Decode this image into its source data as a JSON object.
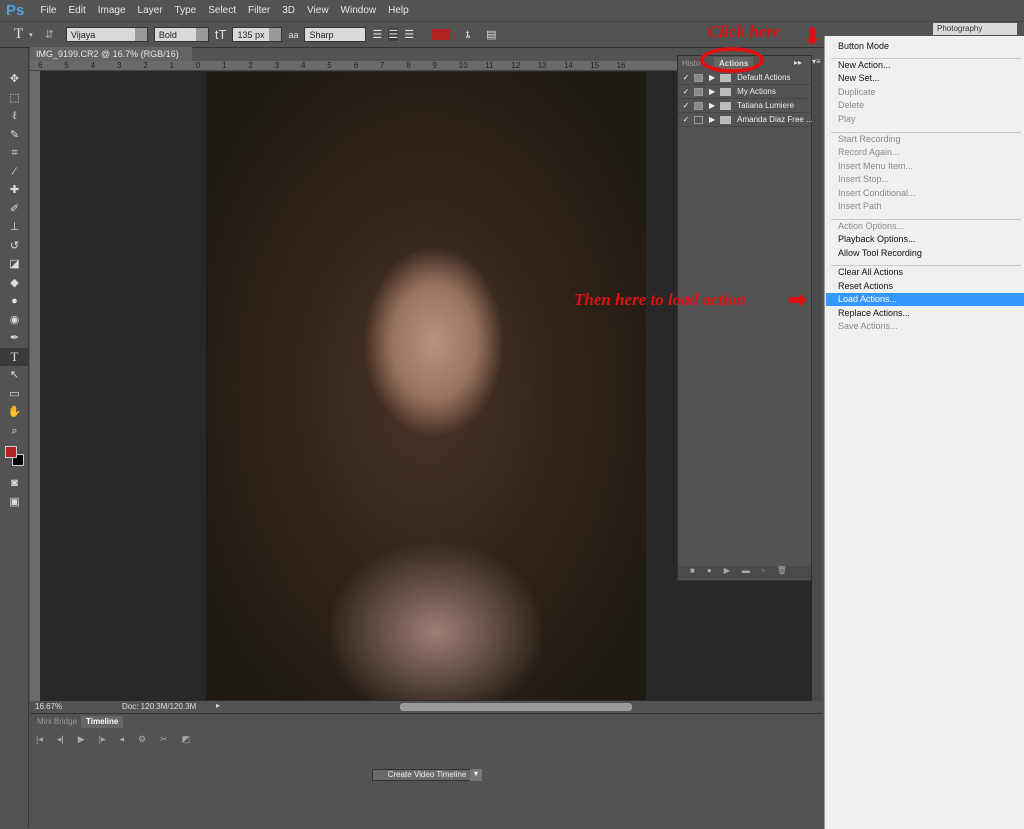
{
  "app": {
    "logo": "Ps",
    "menus": [
      "File",
      "Edit",
      "Image",
      "Layer",
      "Type",
      "Select",
      "Filter",
      "3D",
      "View",
      "Window",
      "Help"
    ],
    "workspace": "Photography"
  },
  "options": {
    "font": "Vijaya",
    "style": "Bold",
    "size": "135 px",
    "aa_label": "aa",
    "aa": "Sharp",
    "color": "#b22222"
  },
  "document": {
    "tab": "IMG_9199.CR2 @ 16.7% (RGB/16)",
    "close": "×",
    "ruler": [
      "6",
      "5",
      "4",
      "3",
      "2",
      "1",
      "0",
      "1",
      "2",
      "3",
      "4",
      "5",
      "6",
      "7",
      "8",
      "9",
      "10",
      "11",
      "12",
      "13",
      "14",
      "15",
      "16"
    ]
  },
  "status": {
    "zoom": "16.67%",
    "doc": "Doc: 120.3M/120.3M"
  },
  "timeline": {
    "tabs": [
      "Mini Bridge",
      "Timeline"
    ],
    "create": "Create Video Timeline"
  },
  "actions_panel": {
    "tabs": [
      "Histo",
      "Actions"
    ],
    "items": [
      {
        "name": "Default Actions",
        "checked": true
      },
      {
        "name": "My Actions",
        "checked": true
      },
      {
        "name": "Tatiana Lumiere",
        "checked": true
      },
      {
        "name": "Amanda Diaz Free ...",
        "checked": true
      }
    ]
  },
  "menu": {
    "items": [
      {
        "label": "Button Mode",
        "enabled": true
      },
      {
        "label": "New Action...",
        "enabled": true
      },
      {
        "label": "New Set...",
        "enabled": true
      },
      {
        "label": "Duplicate",
        "enabled": false
      },
      {
        "label": "Delete",
        "enabled": false
      },
      {
        "label": "Play",
        "enabled": false
      },
      {
        "label": "Start Recording",
        "enabled": false
      },
      {
        "label": "Record Again...",
        "enabled": false
      },
      {
        "label": "Insert Menu Item...",
        "enabled": false
      },
      {
        "label": "Insert Stop...",
        "enabled": false
      },
      {
        "label": "Insert Conditional...",
        "enabled": false
      },
      {
        "label": "Insert Path",
        "enabled": false
      },
      {
        "label": "Action Options...",
        "enabled": false
      },
      {
        "label": "Playback Options...",
        "enabled": true
      },
      {
        "label": "Allow Tool Recording",
        "enabled": true
      },
      {
        "label": "Clear All Actions",
        "enabled": true
      },
      {
        "label": "Reset Actions",
        "enabled": true
      },
      {
        "label": "Load Actions...",
        "enabled": true,
        "highlighted": true
      },
      {
        "label": "Replace Actions...",
        "enabled": true
      },
      {
        "label": "Save Actions...",
        "enabled": false
      }
    ]
  },
  "annotations": {
    "click": "Click here",
    "then": "Then here to load action"
  }
}
